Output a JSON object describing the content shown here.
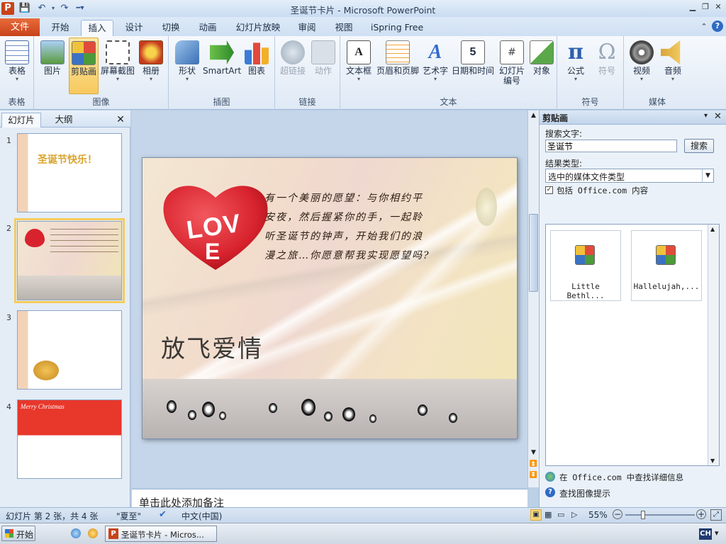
{
  "window": {
    "title": "圣诞节卡片 - Microsoft PowerPoint",
    "app_icon_letter": "P"
  },
  "tabs": {
    "file": "文件",
    "items": [
      "开始",
      "插入",
      "设计",
      "切换",
      "动画",
      "幻灯片放映",
      "审阅",
      "视图",
      "iSpring Free"
    ],
    "active_index": 1
  },
  "ribbon": {
    "groups": {
      "tables": "表格",
      "images": "图像",
      "illustrations": "插图",
      "links": "链接",
      "text": "文本",
      "symbols": "符号",
      "media": "媒体"
    },
    "buttons": {
      "table": "表格",
      "picture": "图片",
      "clipart": "剪贴画",
      "screenshot": "屏幕截图",
      "album": "相册",
      "shapes": "形状",
      "smartart": "SmartArt",
      "chart": "图表",
      "hyperlink": "超链接",
      "action": "动作",
      "textbox": "文本框",
      "header_footer": "页眉和页脚",
      "wordart": "艺术字",
      "datetime": "日期和时间",
      "slide_number_1": "幻灯片",
      "slide_number_2": "编号",
      "object": "对象",
      "equation": "公式",
      "symbol": "符号",
      "video": "视频",
      "audio": "音频"
    }
  },
  "slides_pane": {
    "tab_slides": "幻灯片",
    "tab_outline": "大纲",
    "thumbnails": [
      {
        "num": "1",
        "text": "圣诞节快乐！"
      },
      {
        "num": "2",
        "text": ""
      },
      {
        "num": "3",
        "text": ""
      },
      {
        "num": "4",
        "text": "Merry Christmas"
      }
    ]
  },
  "slide": {
    "poem": "有一个美丽的愿望：与你相约平安夜，然后握紧你的手，一起聆听圣诞节的钟声，开始我们的浪漫之旅…你愿意帮我实现愿望吗?",
    "heart_text_1": "LOV",
    "heart_text_2": "E",
    "calligraphy": "放飞爱情"
  },
  "notes": {
    "placeholder": "单击此处添加备注"
  },
  "clipart_pane": {
    "title": "剪贴画",
    "search_label": "搜索文字:",
    "search_value": "圣诞节",
    "search_button": "搜索",
    "result_type_label": "结果类型:",
    "result_type_value": "选中的媒体文件类型",
    "include_office": "包括 Office.com 内容",
    "results": [
      "Little Bethl...",
      "Hallelujah,..."
    ],
    "link_more": "在 Office.com 中查找详细信息",
    "link_tips": "查找图像提示"
  },
  "statusbar": {
    "slide_info": "幻灯片 第 2 张，共 4 张",
    "theme": "\"夏至\"",
    "language": "中文(中国)",
    "zoom": "55%",
    "zoom_level": 0.55
  },
  "taskbar": {
    "start": "开始",
    "task": "圣诞节卡片 - Micros...",
    "ime": "CH"
  },
  "colors": {
    "file_tab": "#d4532a",
    "accent_active": "#f7c95e",
    "heart": "#d8232e"
  }
}
